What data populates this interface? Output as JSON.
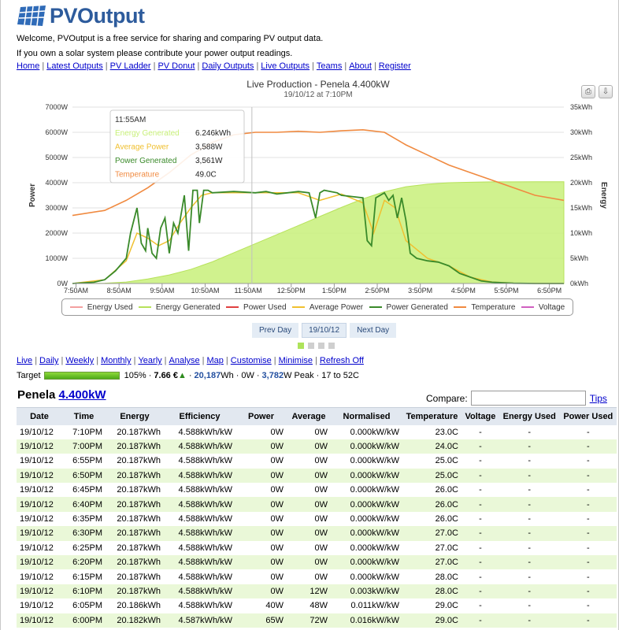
{
  "brand": {
    "name": "PVOutput"
  },
  "intro": {
    "line1": "Welcome, PVOutput is a free service for sharing and comparing PV output data.",
    "line2": "If you own a solar system please contribute your power output readings."
  },
  "topnav": [
    "Home",
    "Latest Outputs",
    "PV Ladder",
    "PV Donut",
    "Daily Outputs",
    "Live Outputs",
    "Teams",
    "About",
    "Register"
  ],
  "chart_header": {
    "title": "Live Production - Penela 4.400kW",
    "subtitle": "19/10/12 at 7:10PM",
    "print_icon": "printer-icon",
    "export_icon": "download-icon"
  },
  "chart_data": {
    "type": "line",
    "title": "Live Production - Penela 4.400kW",
    "subtitle": "19/10/12 at 7:10PM",
    "x_ticks": [
      "7:50AM",
      "8:50AM",
      "9:50AM",
      "10:50AM",
      "11:50AM",
      "12:50PM",
      "1:50PM",
      "2:50PM",
      "3:50PM",
      "4:50PM",
      "5:50PM",
      "6:50PM"
    ],
    "xlim_hours": [
      7.75,
      19.17
    ],
    "ylabel_left": "Power",
    "ylabel_right": "Energy",
    "y_left_ticks": [
      "0W",
      "1000W",
      "2000W",
      "3000W",
      "4000W",
      "5000W",
      "6000W",
      "7000W"
    ],
    "y_left_range": [
      0,
      7000
    ],
    "y_right_ticks": [
      "0kWh",
      "5kWh",
      "10kWh",
      "15kWh",
      "20kWh",
      "25kWh",
      "30kWh",
      "35kWh"
    ],
    "y_right_range": [
      0,
      35
    ],
    "grid": true,
    "legend_position": "bottom",
    "colors": {
      "energy_used": "#f4a0a0",
      "energy_generated": "#c8f07a",
      "energy_generated_line": "#b7e25b",
      "power_used": "#e04040",
      "average_power": "#f0c030",
      "power_generated": "#3a8a2a",
      "temperature": "#f08a40",
      "voltage": "#d060c0"
    },
    "legend": [
      "Energy Used",
      "Energy Generated",
      "Power Used",
      "Average Power",
      "Power Generated",
      "Temperature",
      "Voltage"
    ],
    "series": [
      {
        "name": "Power Generated",
        "axis": "left",
        "x": [
          7.75,
          8.25,
          8.5,
          8.75,
          9.0,
          9.1,
          9.25,
          9.35,
          9.45,
          9.5,
          9.6,
          9.7,
          9.8,
          9.9,
          10.0,
          10.1,
          10.2,
          10.35,
          10.45,
          10.55,
          10.65,
          10.7,
          10.8,
          10.9,
          11.0,
          11.5,
          12.0,
          12.25,
          12.5,
          12.75,
          13.0,
          13.25,
          13.4,
          13.5,
          13.6,
          13.75,
          13.9,
          14.0,
          14.25,
          14.5,
          14.6,
          14.7,
          14.8,
          15.0,
          15.1,
          15.2,
          15.3,
          15.4,
          15.5,
          15.6,
          15.75,
          16.0,
          16.25,
          16.5,
          16.75,
          17.0,
          17.25,
          17.5,
          18.0,
          18.5,
          19.17
        ],
        "y": [
          0,
          50,
          150,
          500,
          1000,
          2000,
          3000,
          1600,
          1300,
          2200,
          1200,
          1000,
          2200,
          2600,
          1200,
          2400,
          2000,
          3500,
          1300,
          3700,
          3700,
          2400,
          3700,
          3700,
          3600,
          3650,
          3600,
          3650,
          3550,
          3600,
          3650,
          3600,
          2600,
          3600,
          3700,
          3650,
          3600,
          3500,
          3450,
          3400,
          1700,
          1500,
          3400,
          3600,
          3300,
          3500,
          2600,
          3400,
          2500,
          1200,
          1000,
          900,
          850,
          700,
          400,
          250,
          100,
          50,
          10,
          0,
          0
        ]
      },
      {
        "name": "Average Power",
        "axis": "left",
        "x": [
          7.75,
          8.5,
          9.0,
          9.25,
          9.5,
          9.75,
          10.0,
          10.25,
          10.5,
          10.75,
          11.0,
          12.0,
          13.0,
          13.5,
          14.0,
          14.5,
          14.75,
          15.0,
          15.25,
          15.5,
          16.0,
          16.5,
          17.0,
          17.5,
          18.0,
          19.17
        ],
        "y": [
          0,
          150,
          900,
          2000,
          1800,
          1500,
          1700,
          2400,
          3000,
          3500,
          3600,
          3600,
          3600,
          3300,
          3550,
          3200,
          2000,
          3300,
          3000,
          1700,
          1000,
          700,
          250,
          60,
          10,
          0
        ]
      },
      {
        "name": "Energy Generated",
        "axis": "right",
        "x": [
          7.75,
          8.5,
          9.0,
          9.5,
          10.0,
          10.5,
          11.0,
          11.5,
          12.0,
          12.5,
          13.0,
          13.5,
          14.0,
          14.5,
          15.0,
          15.5,
          16.0,
          16.5,
          17.0,
          17.5,
          18.0,
          18.5,
          19.17
        ],
        "y": [
          0,
          0.05,
          0.3,
          0.9,
          1.7,
          2.8,
          4.3,
          6.1,
          7.9,
          9.7,
          11.5,
          13.3,
          15.1,
          16.8,
          18.2,
          19.2,
          19.7,
          20.0,
          20.1,
          20.17,
          20.18,
          20.187,
          20.187
        ]
      },
      {
        "name": "Temperature",
        "axis": "right",
        "x": [
          7.75,
          8.5,
          9.0,
          9.5,
          10.0,
          10.5,
          11.0,
          11.5,
          12.0,
          12.5,
          13.0,
          13.5,
          14.0,
          14.5,
          15.0,
          15.2,
          15.5,
          16.0,
          16.5,
          17.0,
          17.5,
          18.0,
          18.5,
          19.17
        ],
        "y": [
          13.5,
          14.5,
          16.5,
          19.0,
          22.0,
          25.5,
          28.0,
          29.5,
          30.0,
          30.0,
          30.2,
          30.0,
          30.3,
          30.5,
          30.0,
          29.0,
          27.5,
          25.5,
          23.5,
          22.0,
          20.5,
          19.0,
          17.5,
          16.5
        ]
      }
    ],
    "tooltip": {
      "time": "11:55AM",
      "rows": [
        {
          "label": "Energy Generated",
          "value": "6.246kWh",
          "color": "#c8f07a"
        },
        {
          "label": "Average Power",
          "value": "3,588W",
          "color": "#f0c030"
        },
        {
          "label": "Power Generated",
          "value": "3,561W",
          "color": "#3a8a2a"
        },
        {
          "label": "Temperature",
          "value": "49.0C",
          "color": "#f08a40"
        }
      ],
      "cursor_hour": 11.92
    }
  },
  "daynav": {
    "prev": "Prev Day",
    "date": "19/10/12",
    "next": "Next Day"
  },
  "subnav": [
    "Live",
    "Daily",
    "Weekly",
    "Monthly",
    "Yearly",
    "Analyse",
    "Map",
    "Customise",
    "Minimise",
    "Refresh Off"
  ],
  "summary": {
    "target_label": "Target",
    "target_pct": "105%",
    "money": "7.66 €",
    "energy": "20,187",
    "energy_unit": "Wh",
    "power": "0W",
    "peak": "3,782",
    "peak_unit": "W Peak",
    "temp_range": "17 to 52C"
  },
  "system": {
    "name": "Penela",
    "size": "4.400kW"
  },
  "compare": {
    "label": "Compare:",
    "value": "",
    "tips": "Tips"
  },
  "table": {
    "headers": [
      "Date",
      "Time",
      "Energy",
      "Efficiency",
      "Power",
      "Average",
      "Normalised",
      "Temperature",
      "Voltage",
      "Energy Used",
      "Power Used"
    ],
    "rows": [
      [
        "19/10/12",
        "7:10PM",
        "20.187kWh",
        "4.588kWh/kW",
        "0W",
        "0W",
        "0.000kW/kW",
        "23.0C",
        "-",
        "-",
        "-"
      ],
      [
        "19/10/12",
        "7:00PM",
        "20.187kWh",
        "4.588kWh/kW",
        "0W",
        "0W",
        "0.000kW/kW",
        "24.0C",
        "-",
        "-",
        "-"
      ],
      [
        "19/10/12",
        "6:55PM",
        "20.187kWh",
        "4.588kWh/kW",
        "0W",
        "0W",
        "0.000kW/kW",
        "25.0C",
        "-",
        "-",
        "-"
      ],
      [
        "19/10/12",
        "6:50PM",
        "20.187kWh",
        "4.588kWh/kW",
        "0W",
        "0W",
        "0.000kW/kW",
        "25.0C",
        "-",
        "-",
        "-"
      ],
      [
        "19/10/12",
        "6:45PM",
        "20.187kWh",
        "4.588kWh/kW",
        "0W",
        "0W",
        "0.000kW/kW",
        "26.0C",
        "-",
        "-",
        "-"
      ],
      [
        "19/10/12",
        "6:40PM",
        "20.187kWh",
        "4.588kWh/kW",
        "0W",
        "0W",
        "0.000kW/kW",
        "26.0C",
        "-",
        "-",
        "-"
      ],
      [
        "19/10/12",
        "6:35PM",
        "20.187kWh",
        "4.588kWh/kW",
        "0W",
        "0W",
        "0.000kW/kW",
        "26.0C",
        "-",
        "-",
        "-"
      ],
      [
        "19/10/12",
        "6:30PM",
        "20.187kWh",
        "4.588kWh/kW",
        "0W",
        "0W",
        "0.000kW/kW",
        "27.0C",
        "-",
        "-",
        "-"
      ],
      [
        "19/10/12",
        "6:25PM",
        "20.187kWh",
        "4.588kWh/kW",
        "0W",
        "0W",
        "0.000kW/kW",
        "27.0C",
        "-",
        "-",
        "-"
      ],
      [
        "19/10/12",
        "6:20PM",
        "20.187kWh",
        "4.588kWh/kW",
        "0W",
        "0W",
        "0.000kW/kW",
        "27.0C",
        "-",
        "-",
        "-"
      ],
      [
        "19/10/12",
        "6:15PM",
        "20.187kWh",
        "4.588kWh/kW",
        "0W",
        "0W",
        "0.000kW/kW",
        "28.0C",
        "-",
        "-",
        "-"
      ],
      [
        "19/10/12",
        "6:10PM",
        "20.187kWh",
        "4.588kWh/kW",
        "0W",
        "12W",
        "0.003kW/kW",
        "28.0C",
        "-",
        "-",
        "-"
      ],
      [
        "19/10/12",
        "6:05PM",
        "20.186kWh",
        "4.588kWh/kW",
        "40W",
        "48W",
        "0.011kW/kW",
        "29.0C",
        "-",
        "-",
        "-"
      ],
      [
        "19/10/12",
        "6:00PM",
        "20.182kWh",
        "4.587kWh/kW",
        "65W",
        "72W",
        "0.016kW/kW",
        "29.0C",
        "-",
        "-",
        "-"
      ]
    ]
  }
}
